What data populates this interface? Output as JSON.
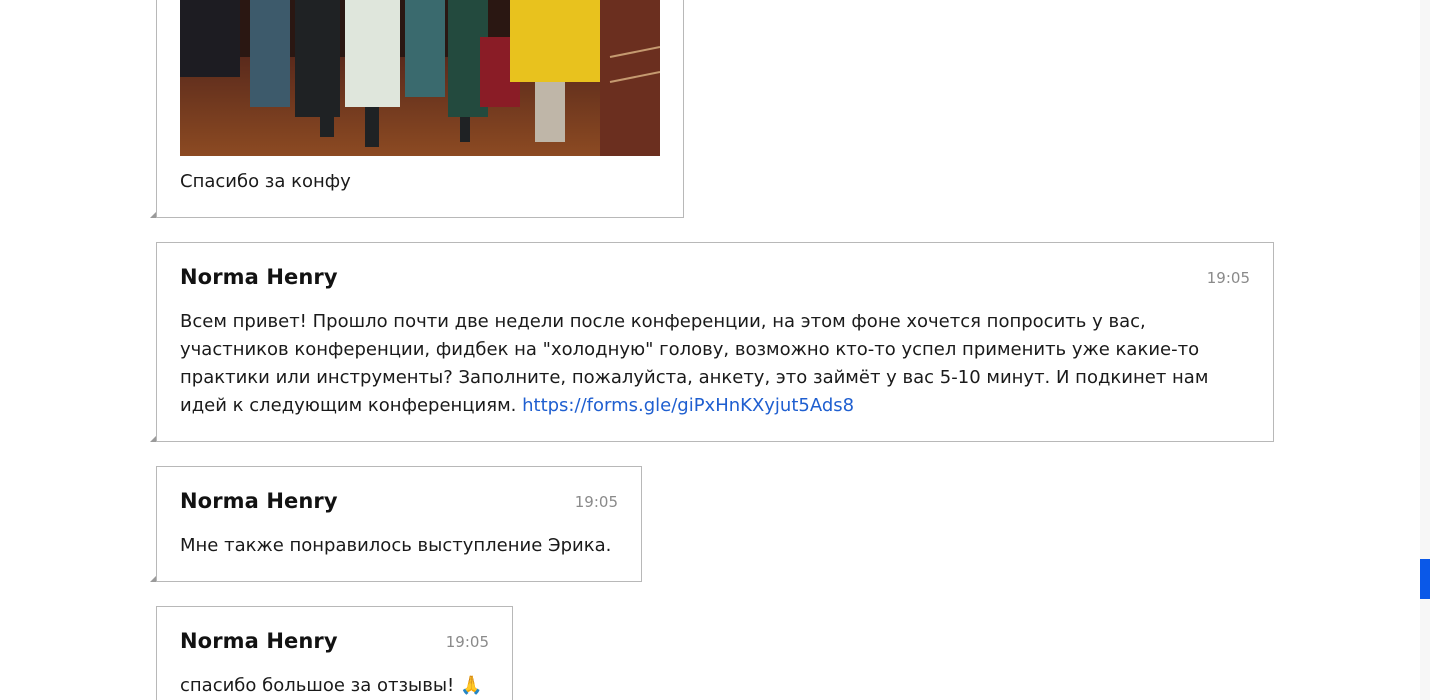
{
  "messages": [
    {
      "caption": "Спасибо за конфу"
    },
    {
      "author": "Norma Henry",
      "time": "19:05",
      "text": "Всем привет! Прошло почти две недели после конференции, на этом фоне хочется попросить у вас, участников конференции, фидбек на \"холодную\" голову, возможно кто-то успел применить уже какие-то практики или инструменты? Заполните, пожалуйста, анкету, это займёт у вас 5-10 минут. И подкинет нам идей к следующим конференциям.",
      "link": "https://forms.gle/giPxHnKXyjut5Ads8"
    },
    {
      "author": "Norma Henry",
      "time": "19:05",
      "text": "Мне также понравилось выступление Эрика."
    },
    {
      "author": "Norma Henry",
      "time": "19:05",
      "text": "спасибо большое за отзывы! 🙏"
    }
  ],
  "colors": {
    "link": "#1f5fd0",
    "scroll_thumb": "#0a58e8",
    "border": "#b8b8b8"
  }
}
